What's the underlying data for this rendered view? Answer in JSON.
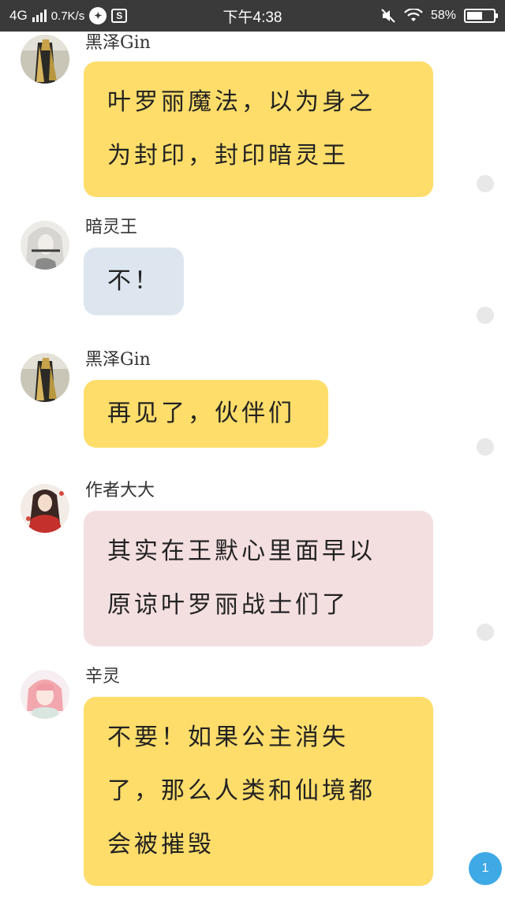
{
  "status_bar": {
    "network": "4G",
    "speed": "0.7K/s",
    "time": "下午4:38",
    "battery_percent": "58%",
    "battery_level": 0.58,
    "icons": [
      "signal-icon",
      "messenger-icon",
      "screenshot-icon",
      "mute-icon",
      "wifi-icon",
      "battery-icon"
    ]
  },
  "colors": {
    "yellow_bubble": "#fedd6a",
    "blue_bubble": "#dde6ef",
    "pink_bubble": "#f4dfe0",
    "unread_badge": "#3fa9e6"
  },
  "messages": [
    {
      "sender": "黑泽Gin",
      "lines": [
        "叶罗丽魔法，以为身之",
        "为封印，封印暗灵王"
      ],
      "bubble_color": "#fedd6a",
      "avatar": "dark-figure"
    },
    {
      "sender": "暗灵王",
      "lines": [
        "不！"
      ],
      "bubble_color": "#dde6ef",
      "avatar": "silver-hair-figure"
    },
    {
      "sender": "黑泽Gin",
      "lines": [
        "再见了，伙伴们"
      ],
      "bubble_color": "#fedd6a",
      "avatar": "dark-figure"
    },
    {
      "sender": "作者大大",
      "lines": [
        "其实在王默心里面早以",
        "原谅叶罗丽战士们了"
      ],
      "bubble_color": "#f4dfe0",
      "avatar": "red-dress-girl"
    },
    {
      "sender": "辛灵",
      "lines": [
        "不要！如果公主消失",
        "了，那么人类和仙境都",
        "会被摧毁"
      ],
      "bubble_color": "#fedd6a",
      "avatar": "pink-hair-girl"
    }
  ],
  "unread_badge": "1"
}
